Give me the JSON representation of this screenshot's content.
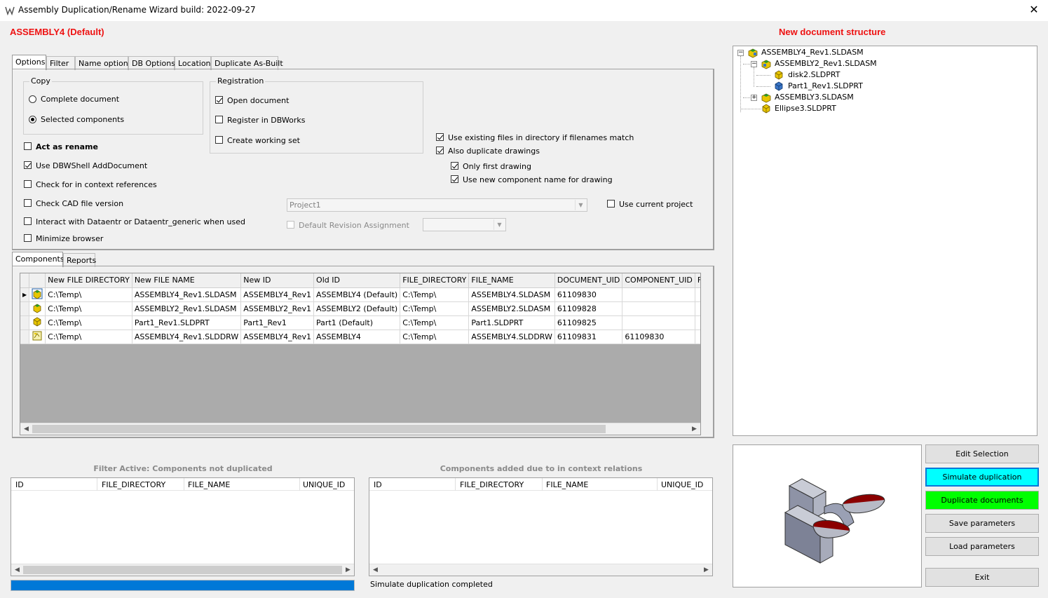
{
  "window": {
    "title": "Assembly Duplication/Rename Wizard build: 2022-09-27",
    "close_glyph": "✕"
  },
  "header": {
    "assembly_title": "ASSEMBLY4 (Default)",
    "structure_title": "New document structure"
  },
  "options_tabs": [
    {
      "label": "Options",
      "selected": true
    },
    {
      "label": "Filter"
    },
    {
      "label": "Name options"
    },
    {
      "label": "DB Options"
    },
    {
      "label": "Location"
    },
    {
      "label": "Duplicate As-Built"
    }
  ],
  "copy_group": {
    "legend": "Copy",
    "complete_document": {
      "label": "Complete document",
      "selected": false
    },
    "selected_components": {
      "label": "Selected components",
      "selected": true
    }
  },
  "registration_group": {
    "legend": "Registration",
    "open_document": {
      "label": "Open document",
      "checked": true
    },
    "register_dbworks": {
      "label": "Register in DBWorks",
      "checked": false
    },
    "create_working_set": {
      "label": "Create working set",
      "checked": false
    }
  },
  "options": {
    "act_as_rename": {
      "label": "Act as rename",
      "checked": false
    },
    "use_dbwshell": {
      "label": "Use DBWShell AddDocument",
      "checked": true
    },
    "check_context": {
      "label": "Check for in context references",
      "checked": false
    },
    "check_cad": {
      "label": "Check CAD file version",
      "checked": false
    },
    "interact_dataentr": {
      "label": "Interact with Dataentr or Dataentr_generic when used",
      "checked": false
    },
    "minimize_browser": {
      "label": "Minimize browser",
      "checked": false
    },
    "use_existing": {
      "label": "Use existing files in directory if filenames match",
      "checked": true
    },
    "duplicate_drawings": {
      "label": "Also duplicate drawings",
      "checked": true
    },
    "only_first_drawing": {
      "label": "Only first drawing",
      "checked": true
    },
    "use_new_component_name": {
      "label": "Use new component name for drawing",
      "checked": true
    },
    "use_current_project": {
      "label": "Use current project",
      "checked": false
    },
    "project_combo": {
      "value": "Project1"
    },
    "default_revision": {
      "label": "Default Revision Assignment",
      "checked": false
    },
    "revision_combo": {
      "value": ""
    }
  },
  "bottom_tabs": [
    {
      "label": "Components",
      "selected": true
    },
    {
      "label": "Reports"
    }
  ],
  "components_grid": {
    "columns": [
      "New FILE DIRECTORY",
      "New FILE NAME",
      "New ID",
      "Old ID",
      "FILE_DIRECTORY",
      "FILE_NAME",
      "DOCUMENT_UID",
      "COMPONENT_UID",
      "FAKE_INFO"
    ],
    "rows": [
      {
        "icon": "assembly-icon",
        "cells": [
          "C:\\Temp\\",
          "ASSEMBLY4_Rev1.SLDASM",
          "ASSEMBLY4_Rev1",
          "ASSEMBLY4 (Default)",
          "C:\\Temp\\",
          "ASSEMBLY4.SLDASM",
          "61109830",
          "",
          ""
        ],
        "current": true
      },
      {
        "icon": "assembly-icon",
        "cells": [
          "C:\\Temp\\",
          "ASSEMBLY2_Rev1.SLDASM",
          "ASSEMBLY2_Rev1",
          "ASSEMBLY2 (Default)",
          "C:\\Temp\\",
          "ASSEMBLY2.SLDASM",
          "61109828",
          "",
          ""
        ]
      },
      {
        "icon": "part-icon",
        "cells": [
          "C:\\Temp\\",
          "Part1_Rev1.SLDPRT",
          "Part1_Rev1",
          "Part1 (Default)",
          "C:\\Temp\\",
          "Part1.SLDPRT",
          "61109825",
          "",
          ""
        ]
      },
      {
        "icon": "drawing-icon",
        "cells": [
          "C:\\Temp\\",
          "ASSEMBLY4_Rev1.SLDDRW",
          "ASSEMBLY4_Rev1",
          "ASSEMBLY4",
          "C:\\Temp\\",
          "ASSEMBLY4.SLDDRW",
          "61109831",
          "61109830",
          ""
        ]
      }
    ]
  },
  "filter_list": {
    "title": "Filter Active: Components not duplicated",
    "columns": [
      "ID",
      "FILE_DIRECTORY",
      "FILE_NAME",
      "UNIQUE_ID"
    ]
  },
  "context_list": {
    "title": "Components added due to in context relations",
    "columns": [
      "ID",
      "FILE_DIRECTORY",
      "FILE_NAME",
      "UNIQUE_ID"
    ]
  },
  "progress": {
    "value": 1.0
  },
  "status_text": "Simulate duplication completed",
  "tree": {
    "nodes": [
      {
        "label": "ASSEMBLY4_Rev1.SLDASM",
        "icon": "assembly-icon",
        "toggle": "−"
      },
      {
        "label": "ASSEMBLY2_Rev1.SLDASM",
        "icon": "assembly-icon",
        "toggle": "−"
      },
      {
        "label": "disk2.SLDPRT",
        "icon": "part-icon"
      },
      {
        "label": "Part1_Rev1.SLDPRT",
        "icon": "part-blue-icon"
      },
      {
        "label": "ASSEMBLY3.SLDASM",
        "icon": "assembly-icon",
        "toggle": "+"
      },
      {
        "label": "Ellipse3.SLDPRT",
        "icon": "part-icon"
      }
    ]
  },
  "buttons": {
    "edit_selection": "Edit Selection",
    "simulate": "Simulate duplication",
    "duplicate": "Duplicate documents",
    "save_params": "Save parameters",
    "load_params": "Load parameters",
    "exit": "Exit"
  },
  "colors": {
    "title_red": "#ee1111",
    "simulate_button": "#00ffff",
    "duplicate_button": "#00ff00",
    "progress_fill": "#0078d7"
  },
  "icons": {
    "app": "app-logo-icon",
    "close": "close-icon",
    "assembly": "assembly-icon",
    "part": "part-icon",
    "drawing": "drawing-icon",
    "preview": "model-preview-icon"
  }
}
